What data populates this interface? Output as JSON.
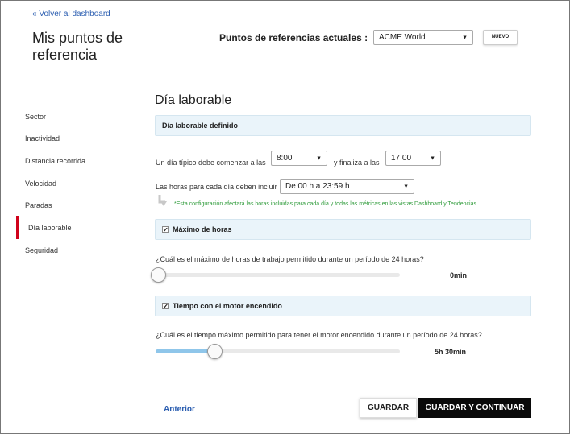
{
  "header": {
    "back_link": "« Volver al dashboard",
    "title": "Mis puntos de referencia",
    "ref_label": "Puntos de referencias actuales :",
    "ref_selected": "ACME World",
    "new_button": "NUEVO"
  },
  "sidebar": {
    "items": [
      {
        "label": "Sector"
      },
      {
        "label": "Inactividad"
      },
      {
        "label": "Distancia recorrida"
      },
      {
        "label": "Velocidad"
      },
      {
        "label": "Paradas"
      },
      {
        "label": "Día laborable",
        "active": true
      },
      {
        "label": "Seguridad"
      }
    ],
    "active_color": "#d0021b"
  },
  "main": {
    "section_title": "Día laborable",
    "workday_panel": {
      "label": "Día laborable definido"
    },
    "workday": {
      "start_text": "Un día típico debe comenzar a las",
      "start_value": "8:00",
      "end_text": "y finaliza a las",
      "end_value": "17:00",
      "hours_text": "Las horas para cada día deben incluir",
      "hours_value": "De 00 h a 23:59 h",
      "note": "*Esta configuración afectará las horas incluidas para cada día y todas las métricas en las vistas Dashboard y Tendencias."
    },
    "max_hours": {
      "label": "Máximo de horas",
      "checked": true,
      "question": "¿Cuál es el máximo de horas de trabajo permitido durante un período de 24 horas?",
      "value_label": "0min",
      "slider_fraction": 0.0
    },
    "engine_time": {
      "label": "Tiempo con el motor encendido",
      "checked": true,
      "question": "¿Cuál es el tiempo máximo permitido para tener el motor encendido durante un período de 24 horas?",
      "value_label": "5h 30min",
      "slider_fraction": 0.24
    }
  },
  "footer": {
    "previous": "Anterior",
    "save": "GUARDAR",
    "save_continue": "GUARDAR Y CONTINUAR"
  },
  "colors": {
    "link": "#2a5db0",
    "panel_bg": "#eaf4fa",
    "note": "#2e9b3a",
    "slider_fill": "#8fc6ea",
    "primary_button": "#0a0a0a"
  }
}
